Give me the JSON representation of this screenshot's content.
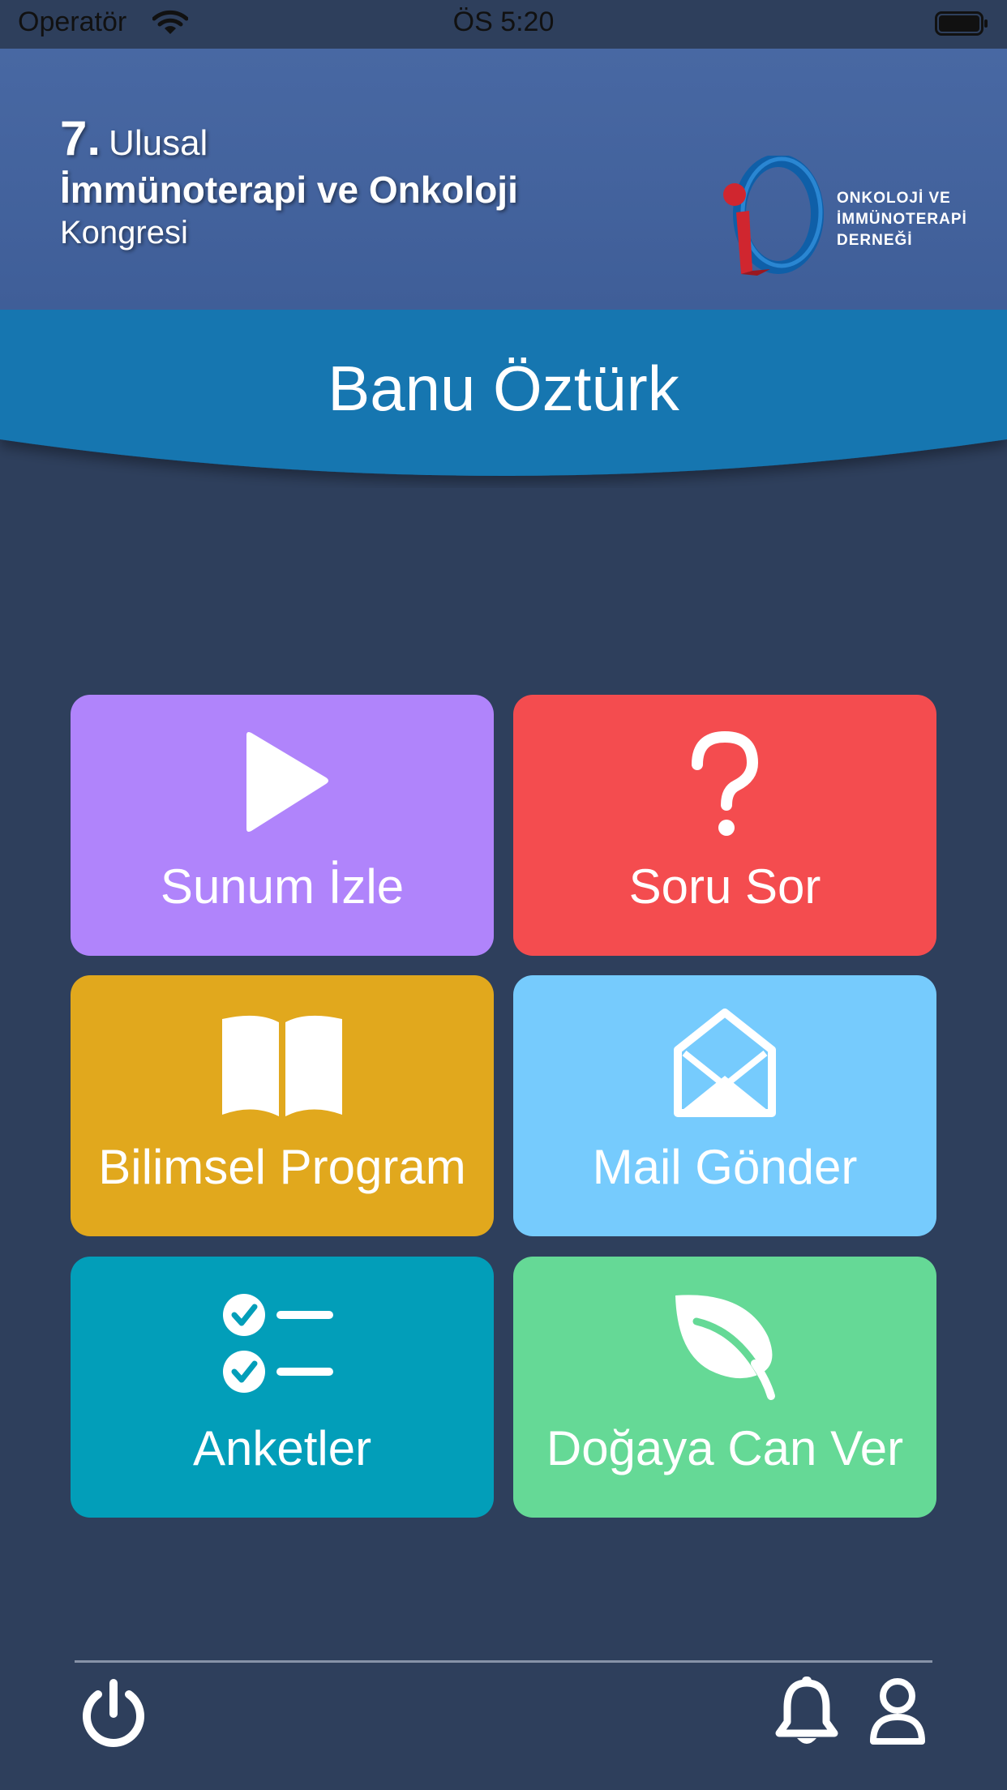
{
  "status_bar": {
    "carrier": "Operatör",
    "time": "ÖS 5:20",
    "icons": [
      "wifi-icon",
      "battery-icon"
    ]
  },
  "header": {
    "congress_number": "7.",
    "congress_line1": "Ulusal",
    "congress_line2": "İmmünoterapi ve Onkoloji",
    "congress_line3": "Kongresi",
    "logo_text_1": "ONKOLOJİ VE",
    "logo_text_2": "İMMÜNOTERAPİ",
    "logo_text_3": "DERNEĞİ"
  },
  "user": {
    "name": "Banu Öztürk"
  },
  "tiles": [
    {
      "label": "Sunum İzle",
      "icon": "play-icon",
      "color": "#b084fb"
    },
    {
      "label": "Soru Sor",
      "icon": "question-icon",
      "color": "#f44c4f"
    },
    {
      "label": "Bilimsel Program",
      "icon": "book-icon",
      "color": "#e1a81d"
    },
    {
      "label": "Mail Gönder",
      "icon": "mail-open-icon",
      "color": "#76cbfd"
    },
    {
      "label": "Anketler",
      "icon": "checklist-icon",
      "color": "#029eb9"
    },
    {
      "label": "Doğaya Can Ver",
      "icon": "leaf-icon",
      "color": "#65d996"
    }
  ],
  "footer": {
    "icons": [
      "power-icon",
      "bell-icon",
      "user-icon"
    ]
  },
  "colors": {
    "background": "#2e3f5c",
    "header": "#4466a0",
    "banner": "#1376b0"
  }
}
